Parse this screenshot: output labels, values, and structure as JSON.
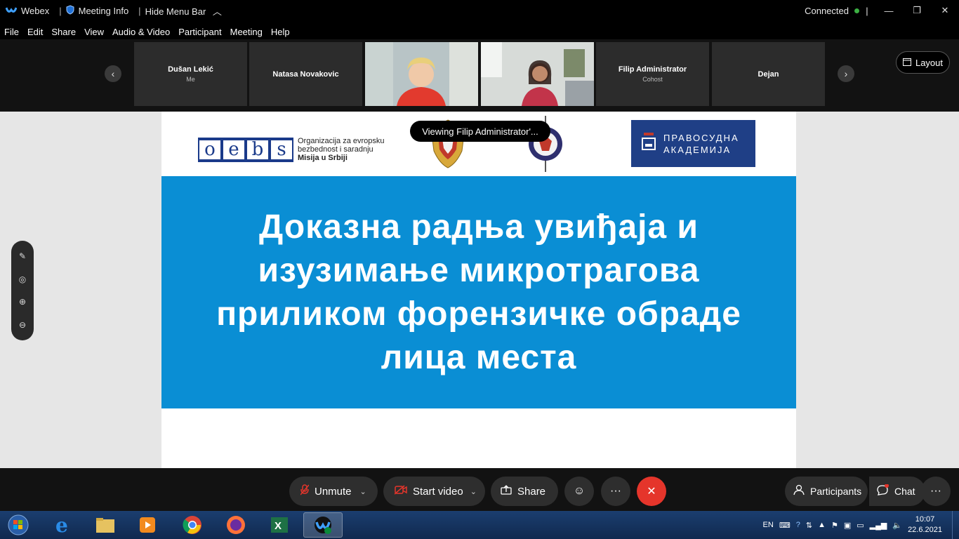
{
  "titlebar": {
    "app": "Webex",
    "meeting_info": "Meeting Info",
    "hide_menu": "Hide Menu Bar",
    "status": "Connected"
  },
  "menu": [
    "File",
    "Edit",
    "Share",
    "View",
    "Audio & Video",
    "Participant",
    "Meeting",
    "Help"
  ],
  "participants": [
    {
      "name": "Dušan Lekić",
      "sub": "Me"
    },
    {
      "name": "Natasa Novakovic",
      "sub": ""
    },
    {
      "name": "",
      "sub": ""
    },
    {
      "name": "",
      "sub": ""
    },
    {
      "name": "Filip Administrator",
      "sub": "Cohost"
    },
    {
      "name": "Dejan",
      "sub": ""
    }
  ],
  "layout_label": "Layout",
  "toast": "Viewing Filip Administrator'...",
  "slide": {
    "oebs_letters": [
      "o",
      "e",
      "b",
      "s"
    ],
    "oebs_line1": "Organizacija za evropsku",
    "oebs_line2": "bezbednost i saradnju",
    "oebs_line3": "Misija u Srbiji",
    "academy_line1": "ПРАВОСУДНА",
    "academy_line2": "АКАДЕМИЈА",
    "title_l1": "Доказна радња увиђаја и",
    "title_l2": "изузимање микротрагова",
    "title_l3": "приликом форензичке обраде",
    "title_l4": "лица места"
  },
  "controls": {
    "unmute": "Unmute",
    "start_video": "Start video",
    "share": "Share",
    "participants": "Participants",
    "chat": "Chat"
  },
  "taskbar": {
    "lang": "EN",
    "time": "10:07",
    "date": "22.6.2021"
  },
  "colors": {
    "slide_band": "#0a8ed4",
    "end_button": "#e5352b",
    "connected": "#3cb043"
  }
}
